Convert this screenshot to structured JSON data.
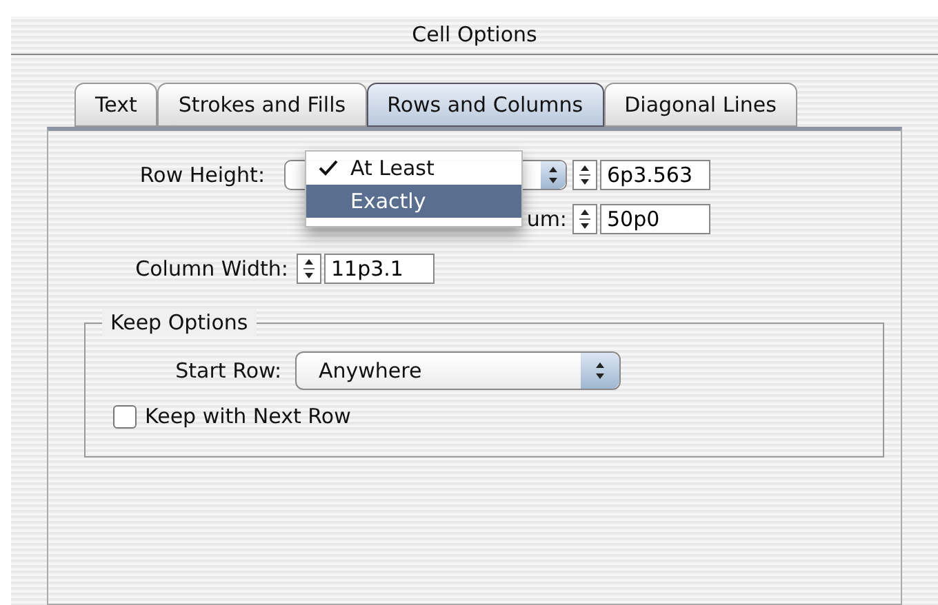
{
  "window": {
    "title": "Cell Options"
  },
  "tabs": [
    {
      "label": "Text",
      "selected": false
    },
    {
      "label": "Strokes and Fills",
      "selected": false
    },
    {
      "label": "Rows and Columns",
      "selected": true
    },
    {
      "label": "Diagonal Lines",
      "selected": false
    }
  ],
  "row_height": {
    "label": "Row Height:",
    "value": "6p3.563",
    "menu": [
      {
        "label": "At Least",
        "checked": true,
        "selected": false
      },
      {
        "label": "Exactly",
        "checked": false,
        "selected": true
      }
    ]
  },
  "maximum": {
    "label": "um:",
    "value": "50p0"
  },
  "column_width": {
    "label": "Column Width:",
    "value": "11p3.1"
  },
  "keep_options": {
    "title": "Keep Options",
    "start_row": {
      "label": "Start Row:",
      "value": "Anywhere"
    },
    "keep_with_next": {
      "label": "Keep with Next Row",
      "checked": false
    }
  }
}
